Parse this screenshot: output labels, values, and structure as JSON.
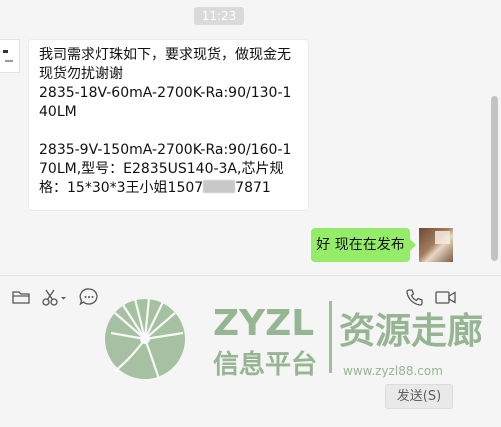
{
  "chat": {
    "timestamp": "11:23",
    "incoming_message": {
      "line1": "我司需求灯珠如下，要求现货，做现金无现货勿扰谢谢",
      "line2": "2835-18V-60mA-2700K-Ra:90/130-140LM",
      "line3": "2835-9V-150mA-2700K-Ra:90/160-170LM,型号：E2835US140-3A,芯片规格：15*30*3王小姐1507",
      "line3_tail": "7871"
    },
    "outgoing_message": "好 现在在发布"
  },
  "toolbar": {
    "icons": [
      "folder-icon",
      "scissors-icon",
      "emoji-icon",
      "phone-icon",
      "video-icon"
    ]
  },
  "watermark": {
    "brand": "ZYZL",
    "name": "资源走廊",
    "subtitle": "信息平台",
    "url": "www.zyzl88.com"
  },
  "send_button": {
    "label": "发送(S)"
  },
  "colors": {
    "outgoing_bubble": "#95ec69",
    "incoming_bubble": "#ffffff",
    "background": "#f5f5f5",
    "watermark": "#7fa67a"
  }
}
